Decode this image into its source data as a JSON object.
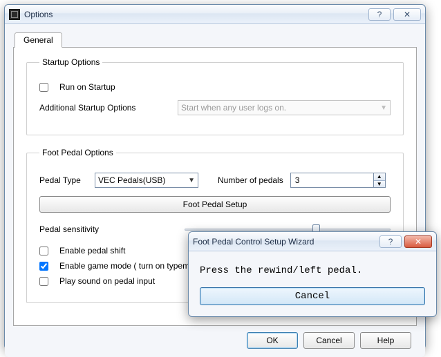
{
  "main": {
    "title": "Options",
    "tab_general": "General",
    "startup": {
      "legend": "Startup Options",
      "run_on_startup_label": "Run on Startup",
      "run_on_startup_checked": false,
      "additional_label": "Additional Startup Options",
      "additional_value": "Start when any user logs on."
    },
    "foot": {
      "legend": "Foot Pedal Options",
      "pedal_type_label": "Pedal Type",
      "pedal_type_value": "VEC Pedals(USB)",
      "num_pedals_label": "Number of pedals",
      "num_pedals_value": "3",
      "setup_button": "Foot Pedal Setup",
      "sensitivity_label": "Pedal sensitivity",
      "enable_shift_label": "Enable pedal shift",
      "enable_shift_checked": false,
      "enable_game_label": "Enable game mode ( turn on typematic )",
      "enable_game_checked": true,
      "play_sound_label": "Play sound on pedal input",
      "play_sound_checked": false
    },
    "buttons": {
      "ok": "OK",
      "cancel": "Cancel",
      "help": "Help"
    }
  },
  "wizard": {
    "title": "Foot Pedal Control Setup Wizard",
    "message": "Press the rewind/left pedal.",
    "cancel": "Cancel"
  }
}
